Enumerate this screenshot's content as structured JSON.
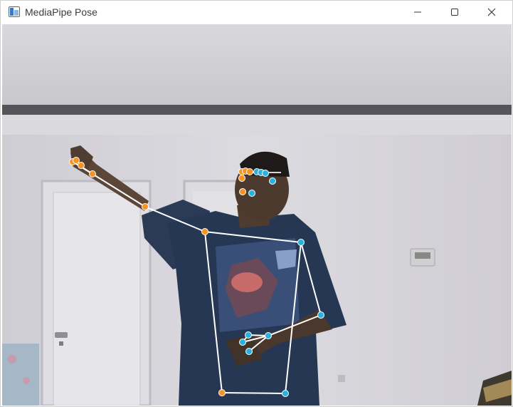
{
  "window": {
    "title": "MediaPipe Pose",
    "icon": "python-window-icon",
    "controls": [
      "minimize-icon",
      "maximize-icon",
      "close-icon"
    ]
  },
  "pose_overlay": {
    "left_side_color": "#f7931e",
    "right_side_color": "#27b2e0",
    "connection_color": "#ffffff"
  }
}
